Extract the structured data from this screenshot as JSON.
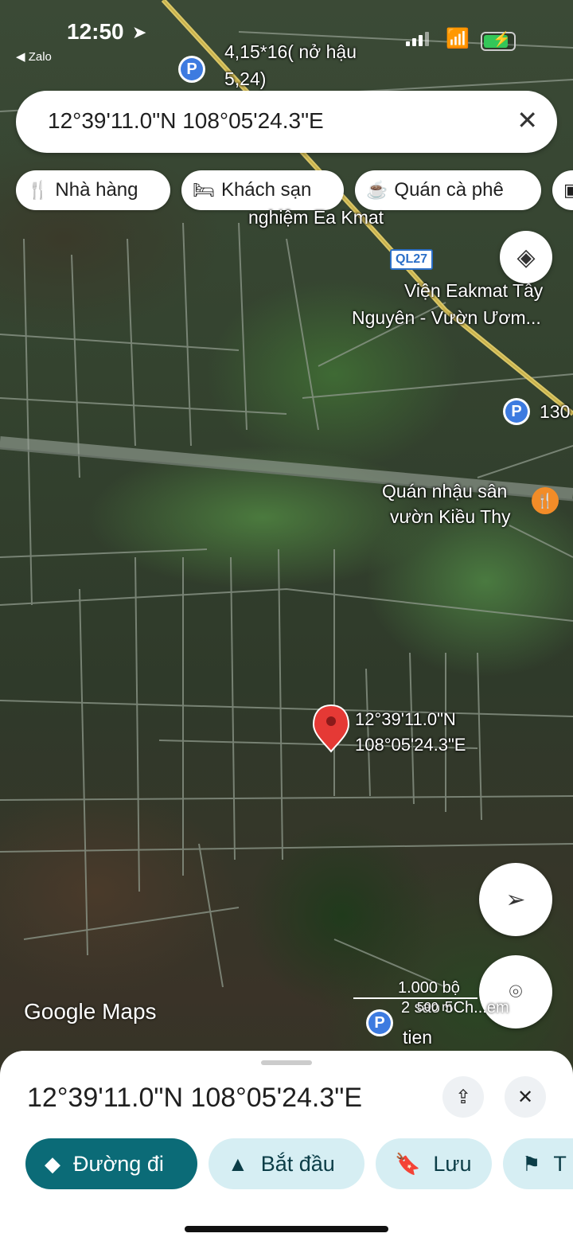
{
  "status_bar": {
    "time": "12:50",
    "back_app": "◀ Zalo"
  },
  "search": {
    "query": "12°39'11.0\"N 108°05'24.3\"E"
  },
  "chips": [
    {
      "label": "Nhà hàng",
      "icon": "restaurant-icon"
    },
    {
      "label": "Khách sạn",
      "icon": "hotel-icon"
    },
    {
      "label": "Quán cà phê",
      "icon": "coffee-icon"
    }
  ],
  "map": {
    "labels": {
      "parking_top": "4,15*16( nở hậu",
      "parking_top_2": "5,24)",
      "nghiem": "nghiệm Ea Kmat",
      "road": "QL27",
      "vien_1": "Viện Eakmat Tây",
      "vien_2": "Nguyên - Vườn Ươm...",
      "parking_right": "130",
      "quan_1": "Quán nhậu sân",
      "quan_2": "vườn Kiều Thy",
      "pin_1": "12°39'11.0\"N",
      "pin_2": "108°05'24.3\"E",
      "scale_1": "1.000 bộ",
      "scale_2": "2 sao 5Ch...em",
      "scale_3": "500 m",
      "bottom_poi": "tien"
    },
    "attribution": "Google Maps"
  },
  "place_sheet": {
    "title": "12°39'11.0\"N 108°05'24.3\"E",
    "actions": [
      {
        "label": "Đường đi",
        "icon": "directions-icon"
      },
      {
        "label": "Bắt đầu",
        "icon": "navigation-icon"
      },
      {
        "label": "Lưu",
        "icon": "bookmark-icon"
      },
      {
        "label": "T",
        "icon": "flag-icon"
      }
    ]
  },
  "colors": {
    "primary": "#0b6b77",
    "secondary": "#d6eef3",
    "pin": "#e53935",
    "poi_blue": "#3d7be0"
  }
}
